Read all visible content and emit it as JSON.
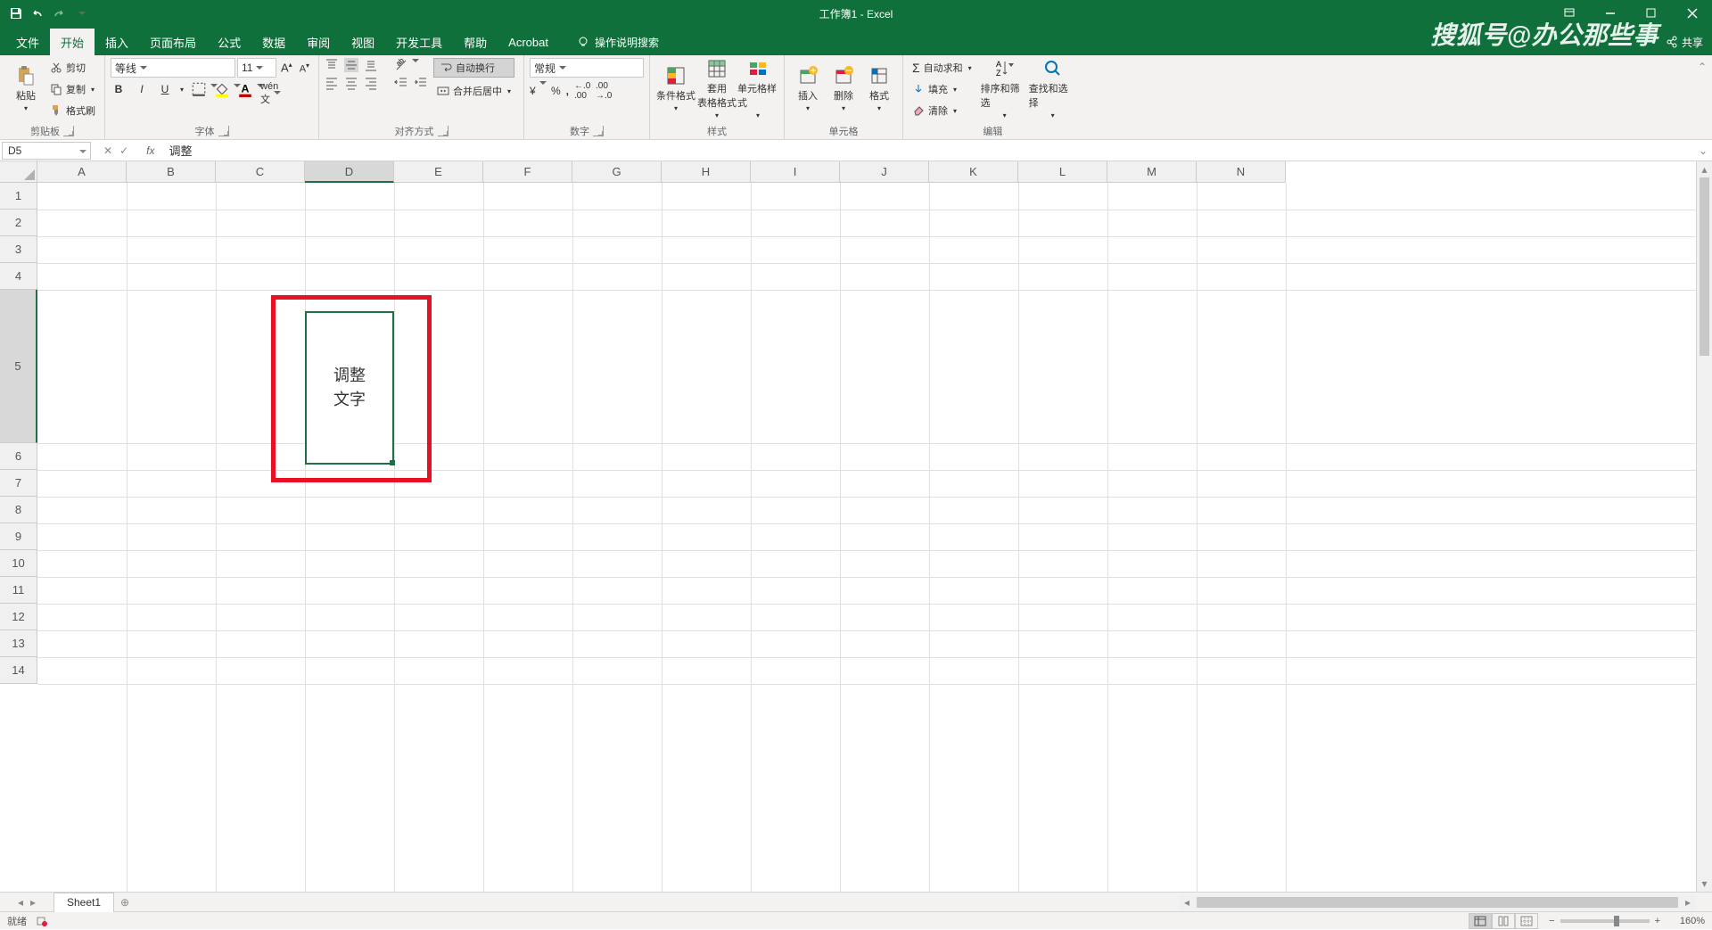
{
  "title": "工作簿1 - Excel",
  "watermark": "搜狐号@办公那些事",
  "share_label": "共享",
  "tabs": [
    "文件",
    "开始",
    "插入",
    "页面布局",
    "公式",
    "数据",
    "审阅",
    "视图",
    "开发工具",
    "帮助",
    "Acrobat"
  ],
  "active_tab_index": 1,
  "tell_me": "操作说明搜索",
  "clipboard": {
    "paste": "粘贴",
    "cut": "剪切",
    "copy": "复制",
    "painter": "格式刷",
    "label": "剪贴板"
  },
  "font": {
    "name": "等线",
    "size": "11",
    "label": "字体"
  },
  "align": {
    "wrap": "自动换行",
    "merge": "合并后居中",
    "label": "对齐方式"
  },
  "number": {
    "format": "常规",
    "label": "数字"
  },
  "styles": {
    "conditional": "条件格式",
    "table": "套用\n表格格式",
    "cell": "单元格样式",
    "label": "样式"
  },
  "cells_group": {
    "insert": "插入",
    "delete": "删除",
    "format": "格式",
    "label": "单元格"
  },
  "editing": {
    "sum": "自动求和",
    "fill": "填充",
    "clear": "清除",
    "sort": "排序和筛选",
    "find": "查找和选择",
    "label": "编辑"
  },
  "namebox": "D5",
  "formula": "调整",
  "columns": [
    "A",
    "B",
    "C",
    "D",
    "E",
    "F",
    "G",
    "H",
    "I",
    "J",
    "K",
    "L",
    "M",
    "N"
  ],
  "rows": [
    "1",
    "2",
    "3",
    "4",
    "5",
    "6",
    "7",
    "8",
    "9",
    "10",
    "11",
    "12",
    "13",
    "14"
  ],
  "active_col": "D",
  "active_row": "5",
  "cell_content": "调整\n文字",
  "sheet_tab": "Sheet1",
  "status": "就绪",
  "zoom": "160%"
}
